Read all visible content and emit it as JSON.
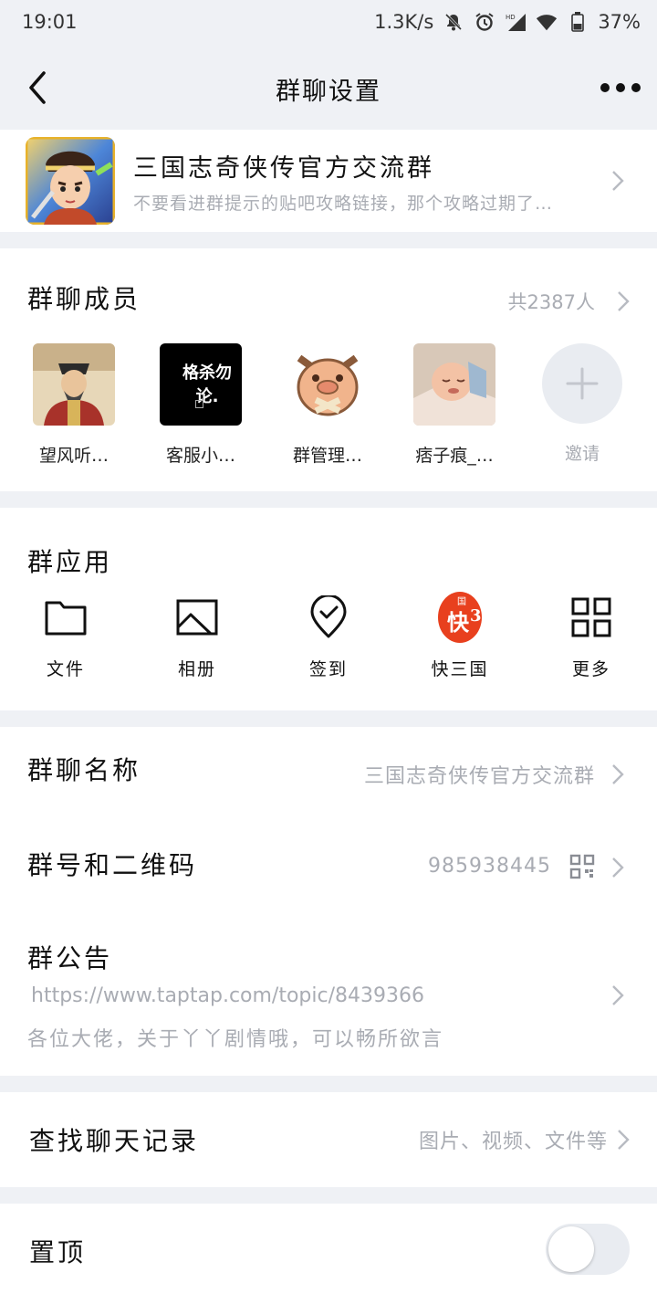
{
  "status_bar": {
    "time": "19:01",
    "speed": "1.3K/s",
    "battery": "37%"
  },
  "nav": {
    "title": "群聊设置",
    "back_icon": "chevron-left-icon",
    "more_icon": "more-dots-icon"
  },
  "group": {
    "name": "三国志奇侠传官方交流群",
    "description": "不要看进群提示的贴吧攻略链接，那个攻略过期了…"
  },
  "members": {
    "title": "群聊成员",
    "count": "共2387人",
    "list": [
      {
        "name": "望风听…"
      },
      {
        "name": "客服小…",
        "avatar_text": "格杀勿论."
      },
      {
        "name": "群管理…"
      },
      {
        "name": "痞子痕_…"
      }
    ],
    "invite_label": "邀请"
  },
  "apps": {
    "title": "群应用",
    "items": [
      {
        "label": "文件",
        "icon": "folder-icon"
      },
      {
        "label": "相册",
        "icon": "image-icon"
      },
      {
        "label": "签到",
        "icon": "checkin-icon"
      },
      {
        "label": "快三国",
        "icon": "kuaisanguo-icon",
        "icon_text": "快",
        "icon_top_text": "国"
      },
      {
        "label": "更多",
        "icon": "grid-icon"
      }
    ]
  },
  "info": {
    "name_label": "群聊名称",
    "name_value": "三国志奇侠传官方交流群",
    "number_label": "群号和二维码",
    "number_value": "985938445",
    "notice_label": "群公告",
    "notice_line1": "https://www.taptap.com/topic/8439366",
    "notice_line2": "各位大佬，关于丫丫剧情哦，可以畅所欲言"
  },
  "search": {
    "label": "查找聊天记录",
    "hint": "图片、视频、文件等"
  },
  "pin": {
    "label": "置顶",
    "enabled": false
  },
  "colors": {
    "background": "#eff1f5",
    "secondary_text": "#a9acb3",
    "app_red": "#e8401e"
  }
}
